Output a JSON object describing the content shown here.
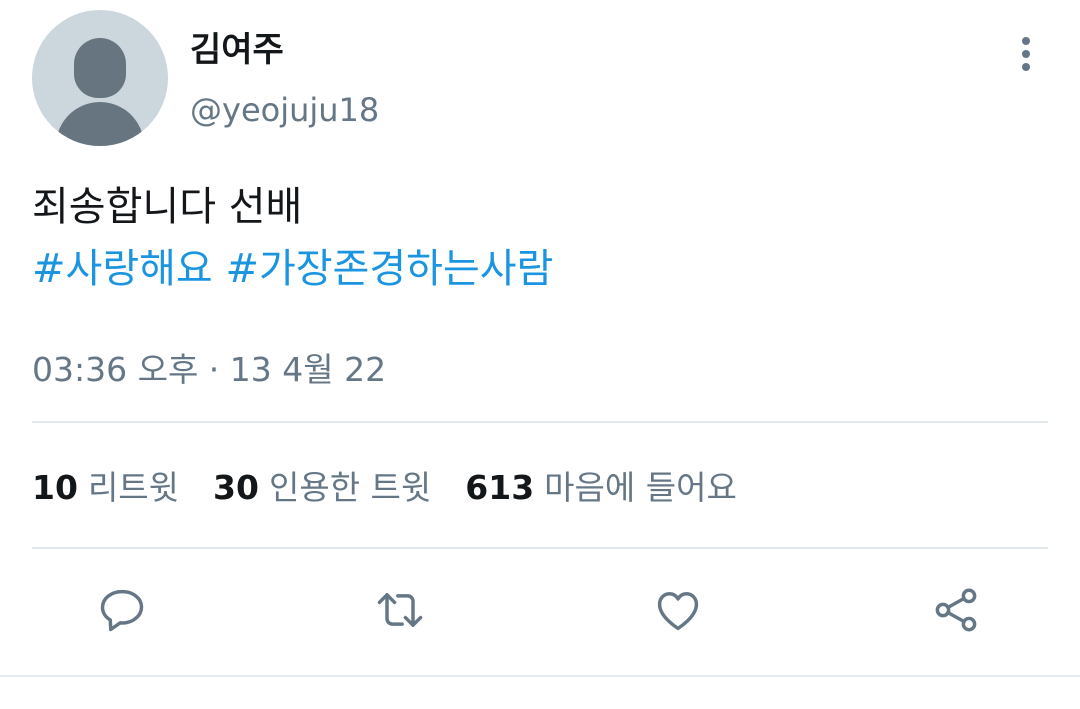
{
  "tweet": {
    "author": {
      "display_name": "김여주",
      "handle": "@yeojuju18",
      "avatar_icon": "default-avatar-icon"
    },
    "text_line1": "죄송합니다 선배",
    "hashtags": [
      "#사랑해요",
      "#가장존경하는사람"
    ],
    "timestamp": "03:36 오후 · 13 4월 22"
  },
  "stats": {
    "retweets": {
      "count": "10",
      "label": "리트윗"
    },
    "quotes": {
      "count": "30",
      "label": "인용한 트윗"
    },
    "likes": {
      "count": "613",
      "label": "마음에 들어요"
    }
  },
  "actions": {
    "reply_icon": "reply-icon",
    "retweet_icon": "retweet-icon",
    "like_icon": "heart-icon",
    "share_icon": "share-icon"
  },
  "colors": {
    "link": "#1b95e0",
    "secondary_text": "#657786",
    "primary_text": "#14171a",
    "divider": "#e1e8ed",
    "avatar_bg": "#ccd6dd",
    "avatar_fg": "#66757f"
  }
}
